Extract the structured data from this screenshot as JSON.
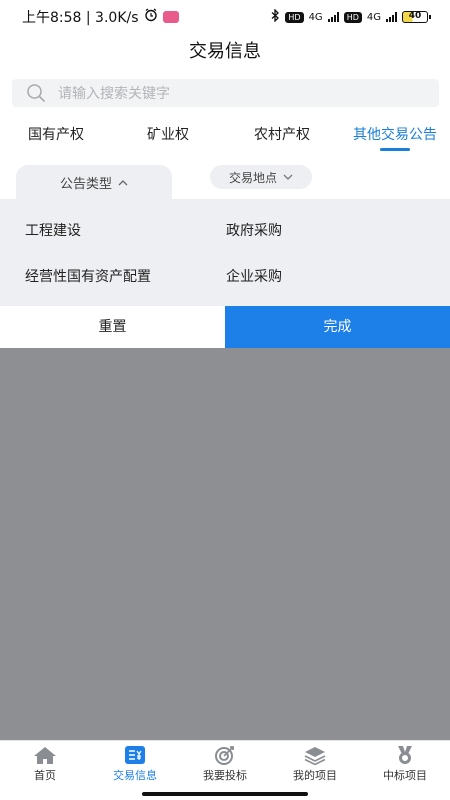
{
  "status": {
    "time_speed": "上午8:58 | 3.0K/s",
    "battery": "40",
    "network1": "4G",
    "network2": "4G",
    "hd": "HD"
  },
  "header": {
    "title": "交易信息"
  },
  "search": {
    "placeholder": "请输入搜索关键字"
  },
  "tabs": [
    {
      "label": "国有产权"
    },
    {
      "label": "矿业权"
    },
    {
      "label": "农村产权"
    },
    {
      "label": "其他交易公告"
    }
  ],
  "filters": {
    "type_label": "公告类型",
    "location_label": "交易地点"
  },
  "options": [
    {
      "label": "工程建设"
    },
    {
      "label": "政府采购"
    },
    {
      "label": "经营性国有资产配置"
    },
    {
      "label": "企业采购"
    }
  ],
  "actions": {
    "reset": "重置",
    "done": "完成"
  },
  "nav": [
    {
      "label": "首页"
    },
    {
      "label": "交易信息"
    },
    {
      "label": "我要投标"
    },
    {
      "label": "我的项目"
    },
    {
      "label": "中标项目"
    }
  ],
  "colors": {
    "accent": "#1d7fe8",
    "overlay": "#8e8f92"
  }
}
